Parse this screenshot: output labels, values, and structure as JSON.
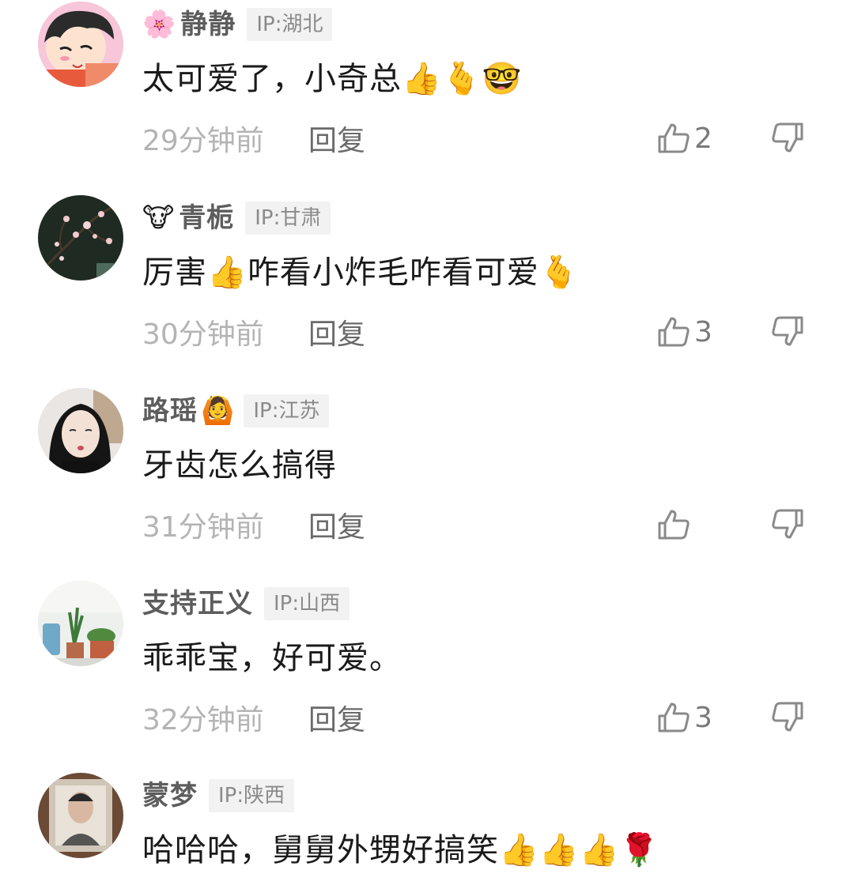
{
  "comments": [
    {
      "name_prefix_emoji": "🌸",
      "username": "静静",
      "name_suffix_emoji": "",
      "ip": "IP:湖北",
      "text": "太可爱了，小奇总",
      "emojis": "👍🫰🤓",
      "time": "29分钟前",
      "reply": "回复",
      "likes": "2"
    },
    {
      "name_prefix_emoji": "🐮",
      "username": "青栀",
      "name_suffix_emoji": "",
      "ip": "IP:甘肃",
      "text": "厉害",
      "text_emoji_mid": "👍",
      "text_after": "咋看小炸毛咋看可爱",
      "emojis": "🫰",
      "time": "30分钟前",
      "reply": "回复",
      "likes": "3"
    },
    {
      "name_prefix_emoji": "",
      "username": "路瑶",
      "name_suffix_emoji": "🙆",
      "ip": "IP:江苏",
      "text": "牙齿怎么搞得",
      "emojis": "",
      "time": "31分钟前",
      "reply": "回复",
      "likes": ""
    },
    {
      "name_prefix_emoji": "",
      "username": "支持正义",
      "name_suffix_emoji": "",
      "ip": "IP:山西",
      "text": "乖乖宝，好可爱。",
      "emojis": "",
      "time": "32分钟前",
      "reply": "回复",
      "likes": "3"
    },
    {
      "name_prefix_emoji": "",
      "username": "蒙梦",
      "name_suffix_emoji": "",
      "ip": "IP:陕西",
      "text": "哈哈哈，舅舅外甥好搞笑",
      "emojis": "👍👍👍🌹",
      "time": "",
      "reply": "",
      "likes": ""
    }
  ],
  "icons": {
    "like": "thumbs-up-outline-icon",
    "dislike": "thumbs-down-outline-icon"
  },
  "colors": {
    "username": "#5d5d5d",
    "ip_badge_bg": "#f2f2f2",
    "time": "#b4b4b4",
    "reply": "#6a6a6a",
    "icon": "#8a8a8a"
  }
}
